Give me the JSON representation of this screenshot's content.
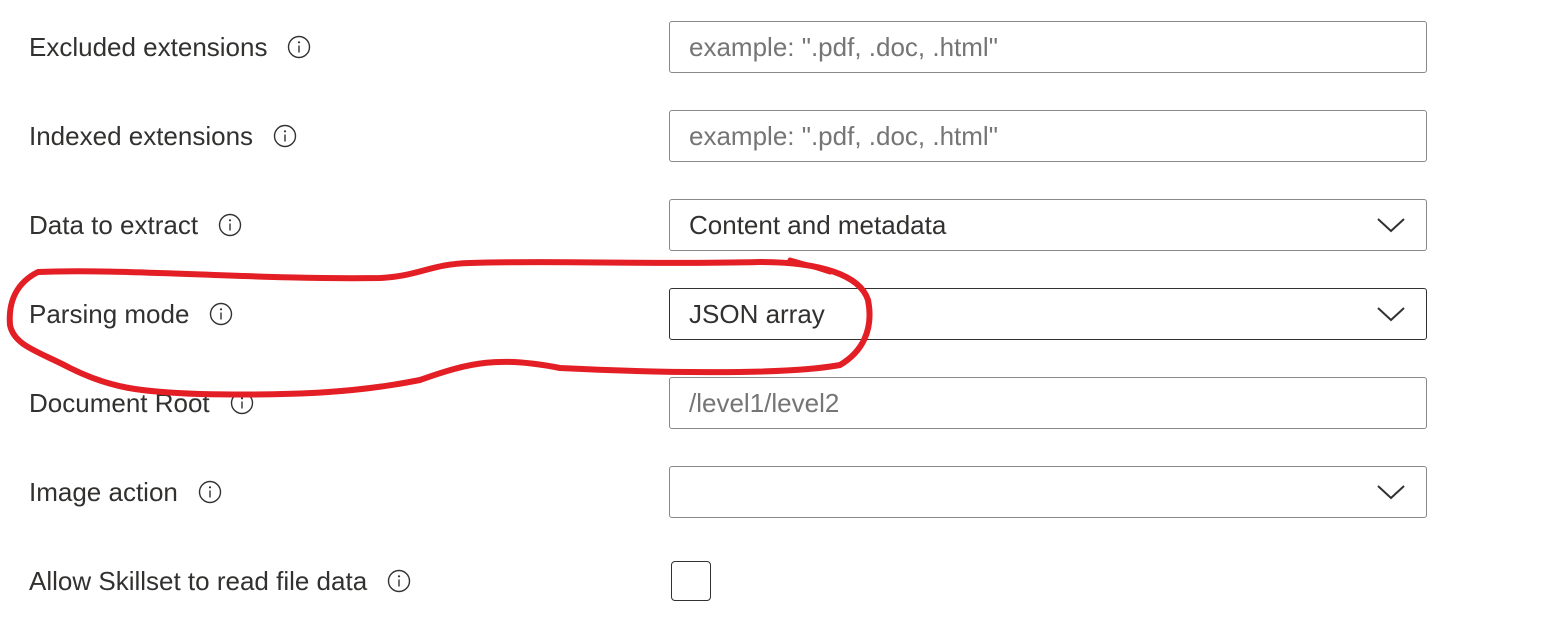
{
  "rows": [
    {
      "label": "Excluded extensions",
      "type": "text",
      "placeholder": "example: \".pdf, .doc, .html\"",
      "value": ""
    },
    {
      "label": "Indexed extensions",
      "type": "text",
      "placeholder": "example: \".pdf, .doc, .html\"",
      "value": ""
    },
    {
      "label": "Data to extract",
      "type": "dropdown",
      "value": "Content and metadata"
    },
    {
      "label": "Parsing mode",
      "type": "dropdown",
      "value": "JSON array"
    },
    {
      "label": "Document Root",
      "type": "text",
      "placeholder": "/level1/level2",
      "value": ""
    },
    {
      "label": "Image action",
      "type": "dropdown",
      "value": ""
    },
    {
      "label": "Allow Skillset to read file data",
      "type": "checkbox",
      "checked": false
    }
  ],
  "icons": {
    "info": "info-icon",
    "chevron": "chevron-down-icon"
  },
  "colors": {
    "annotation": "#e31e24",
    "text": "#323130",
    "placeholder": "#757575",
    "border": "#8a8886"
  }
}
